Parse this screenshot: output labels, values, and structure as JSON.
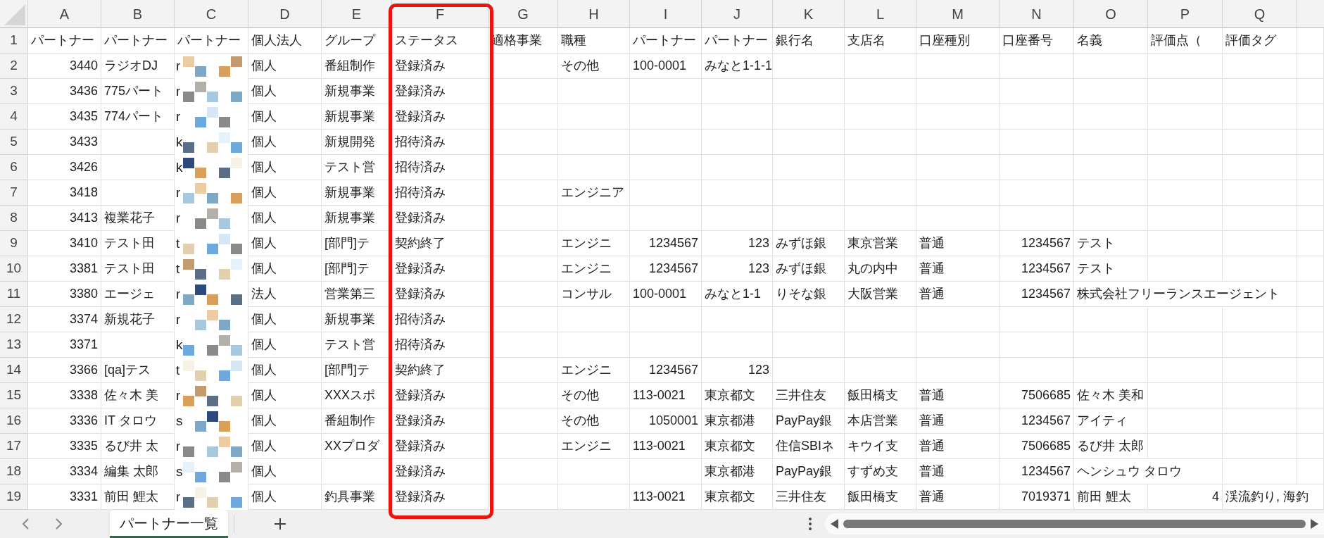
{
  "sheet": {
    "columns": [
      {
        "letter": "A",
        "highlighted": false
      },
      {
        "letter": "B",
        "highlighted": false
      },
      {
        "letter": "C",
        "highlighted": false
      },
      {
        "letter": "D",
        "highlighted": false
      },
      {
        "letter": "E",
        "highlighted": false
      },
      {
        "letter": "F",
        "highlighted": true
      },
      {
        "letter": "G",
        "highlighted": false
      },
      {
        "letter": "H",
        "highlighted": false
      },
      {
        "letter": "I",
        "highlighted": false
      },
      {
        "letter": "J",
        "highlighted": false
      },
      {
        "letter": "K",
        "highlighted": false
      },
      {
        "letter": "L",
        "highlighted": false
      },
      {
        "letter": "M",
        "highlighted": false
      },
      {
        "letter": "N",
        "highlighted": false
      },
      {
        "letter": "O",
        "highlighted": false
      },
      {
        "letter": "P",
        "highlighted": false
      },
      {
        "letter": "Q",
        "highlighted": false
      }
    ],
    "rows": [
      {
        "number": "1",
        "redacted": false,
        "cells": [
          "パートナー",
          "パートナー",
          "パートナー",
          "個人法人",
          "グループ",
          "ステータス",
          "適格事業",
          "職種",
          "パートナー",
          "パートナー",
          "銀行名",
          "支店名",
          "口座種別",
          "口座番号",
          "名義",
          "評価点（",
          "評価タグ"
        ],
        "numeric": [
          false,
          false,
          false,
          false,
          false,
          false,
          false,
          false,
          false,
          false,
          false,
          false,
          false,
          false,
          false,
          false,
          false
        ]
      },
      {
        "number": "2",
        "redacted": true,
        "redacted_head": "r",
        "cells": [
          "3440",
          "ラジオDJ",
          "",
          "個人",
          "番組制作",
          "登録済み",
          "",
          "その他",
          "100-0001",
          "みなと1-1-1",
          "",
          "",
          "",
          "",
          "",
          "",
          ""
        ],
        "numeric": [
          true,
          false,
          false,
          false,
          false,
          false,
          false,
          false,
          false,
          false,
          false,
          false,
          false,
          false,
          false,
          false,
          false
        ]
      },
      {
        "number": "3",
        "redacted": true,
        "redacted_head": "r",
        "cells": [
          "3436",
          "775パート",
          "",
          "個人",
          "新規事業",
          "登録済み",
          "",
          "",
          "",
          "",
          "",
          "",
          "",
          "",
          "",
          "",
          ""
        ],
        "numeric": [
          true,
          false,
          false,
          false,
          false,
          false,
          false,
          false,
          false,
          false,
          false,
          false,
          false,
          false,
          false,
          false,
          false
        ]
      },
      {
        "number": "4",
        "redacted": true,
        "redacted_head": "r",
        "cells": [
          "3435",
          "774パート",
          "",
          "個人",
          "新規事業",
          "登録済み",
          "",
          "",
          "",
          "",
          "",
          "",
          "",
          "",
          "",
          "",
          ""
        ],
        "numeric": [
          true,
          false,
          false,
          false,
          false,
          false,
          false,
          false,
          false,
          false,
          false,
          false,
          false,
          false,
          false,
          false,
          false
        ]
      },
      {
        "number": "5",
        "redacted": true,
        "redacted_head": "k",
        "cells": [
          "3433",
          "",
          "",
          "個人",
          "新規開発",
          "招待済み",
          "",
          "",
          "",
          "",
          "",
          "",
          "",
          "",
          "",
          "",
          ""
        ],
        "numeric": [
          true,
          false,
          false,
          false,
          false,
          false,
          false,
          false,
          false,
          false,
          false,
          false,
          false,
          false,
          false,
          false,
          false
        ]
      },
      {
        "number": "6",
        "redacted": true,
        "redacted_head": "k",
        "cells": [
          "3426",
          "",
          "",
          "個人",
          "テスト営",
          "招待済み",
          "",
          "",
          "",
          "",
          "",
          "",
          "",
          "",
          "",
          "",
          ""
        ],
        "numeric": [
          true,
          false,
          false,
          false,
          false,
          false,
          false,
          false,
          false,
          false,
          false,
          false,
          false,
          false,
          false,
          false,
          false
        ]
      },
      {
        "number": "7",
        "redacted": true,
        "redacted_head": "r",
        "cells": [
          "3418",
          "",
          "",
          "個人",
          "新規事業",
          "招待済み",
          "",
          "エンジニア",
          "",
          "",
          "",
          "",
          "",
          "",
          "",
          "",
          ""
        ],
        "numeric": [
          true,
          false,
          false,
          false,
          false,
          false,
          false,
          false,
          false,
          false,
          false,
          false,
          false,
          false,
          false,
          false,
          false
        ]
      },
      {
        "number": "8",
        "redacted": true,
        "redacted_head": "r",
        "cells": [
          "3413",
          "複業花子",
          "",
          "個人",
          "新規事業",
          "登録済み",
          "",
          "",
          "",
          "",
          "",
          "",
          "",
          "",
          "",
          "",
          ""
        ],
        "numeric": [
          true,
          false,
          false,
          false,
          false,
          false,
          false,
          false,
          false,
          false,
          false,
          false,
          false,
          false,
          false,
          false,
          false
        ]
      },
      {
        "number": "9",
        "redacted": true,
        "redacted_head": "t",
        "cells": [
          "3410",
          "テスト田",
          "",
          "個人",
          "[部門]テ",
          "契約終了",
          "",
          "エンジニ",
          "1234567",
          "123",
          "みずほ銀",
          "東京営業",
          "普通",
          "1234567",
          "テスト",
          "",
          ""
        ],
        "numeric": [
          true,
          false,
          false,
          false,
          false,
          false,
          false,
          false,
          true,
          true,
          false,
          false,
          false,
          true,
          false,
          false,
          false
        ]
      },
      {
        "number": "10",
        "redacted": true,
        "redacted_head": "t",
        "cells": [
          "3381",
          "テスト田",
          "",
          "個人",
          "[部門]テ",
          "登録済み",
          "",
          "エンジニ",
          "1234567",
          "123",
          "みずほ銀",
          "丸の内中",
          "普通",
          "1234567",
          "テスト",
          "",
          ""
        ],
        "numeric": [
          true,
          false,
          false,
          false,
          false,
          false,
          false,
          false,
          true,
          true,
          false,
          false,
          false,
          true,
          false,
          false,
          false
        ]
      },
      {
        "number": "11",
        "redacted": true,
        "redacted_head": "r",
        "cells": [
          "3380",
          "エージェ",
          "",
          "法人",
          "営業第三",
          "登録済み",
          "",
          "コンサル",
          "100-0001",
          "みなと1-1",
          "りそな銀",
          "大阪営業",
          "普通",
          "1234567",
          "株式会社フリーランスエージェント",
          "",
          ""
        ],
        "numeric": [
          true,
          false,
          false,
          false,
          false,
          false,
          false,
          false,
          false,
          false,
          false,
          false,
          false,
          true,
          false,
          false,
          false
        ]
      },
      {
        "number": "12",
        "redacted": true,
        "redacted_head": "r",
        "cells": [
          "3374",
          "新規花子",
          "",
          "個人",
          "新規事業",
          "招待済み",
          "",
          "",
          "",
          "",
          "",
          "",
          "",
          "",
          "",
          "",
          ""
        ],
        "numeric": [
          true,
          false,
          false,
          false,
          false,
          false,
          false,
          false,
          false,
          false,
          false,
          false,
          false,
          false,
          false,
          false,
          false
        ]
      },
      {
        "number": "13",
        "redacted": true,
        "redacted_head": "k",
        "cells": [
          "3371",
          "",
          "",
          "個人",
          "テスト営",
          "招待済み",
          "",
          "",
          "",
          "",
          "",
          "",
          "",
          "",
          "",
          "",
          ""
        ],
        "numeric": [
          true,
          false,
          false,
          false,
          false,
          false,
          false,
          false,
          false,
          false,
          false,
          false,
          false,
          false,
          false,
          false,
          false
        ]
      },
      {
        "number": "14",
        "redacted": true,
        "redacted_head": "t",
        "cells": [
          "3366",
          "[qa]テス",
          "",
          "個人",
          "[部門]テ",
          "契約終了",
          "",
          "エンジニ",
          "1234567",
          "123",
          "",
          "",
          "",
          "",
          "",
          "",
          ""
        ],
        "numeric": [
          true,
          false,
          false,
          false,
          false,
          false,
          false,
          false,
          true,
          true,
          false,
          false,
          false,
          false,
          false,
          false,
          false
        ]
      },
      {
        "number": "15",
        "redacted": true,
        "redacted_head": "r",
        "cells": [
          "3338",
          "佐々木 美",
          "",
          "個人",
          "XXXスポ",
          "登録済み",
          "",
          "その他",
          "113-0021",
          "東京都文",
          "三井住友",
          "飯田橋支",
          "普通",
          "7506685",
          "佐々木 美和",
          "",
          ""
        ],
        "numeric": [
          true,
          false,
          false,
          false,
          false,
          false,
          false,
          false,
          false,
          false,
          false,
          false,
          false,
          true,
          false,
          false,
          false
        ]
      },
      {
        "number": "16",
        "redacted": true,
        "redacted_head": "s",
        "cells": [
          "3336",
          "IT タロウ",
          "",
          "個人",
          "番組制作",
          "登録済み",
          "",
          "その他",
          "1050001",
          "東京都港",
          "PayPay銀",
          "本店営業",
          "普通",
          "1234567",
          "アイティ",
          "",
          ""
        ],
        "numeric": [
          true,
          false,
          false,
          false,
          false,
          false,
          false,
          false,
          true,
          false,
          false,
          false,
          false,
          true,
          false,
          false,
          false
        ]
      },
      {
        "number": "17",
        "redacted": true,
        "redacted_head": "r",
        "cells": [
          "3335",
          "るび井 太",
          "",
          "個人",
          "XXプロダ",
          "登録済み",
          "",
          "エンジニ",
          "113-0021",
          "東京都文",
          "住信SBIネ",
          "キウイ支",
          "普通",
          "7506685",
          "るび井 太郎",
          "",
          ""
        ],
        "numeric": [
          true,
          false,
          false,
          false,
          false,
          false,
          false,
          false,
          false,
          false,
          false,
          false,
          false,
          true,
          false,
          false,
          false
        ]
      },
      {
        "number": "18",
        "redacted": true,
        "redacted_head": "s",
        "cells": [
          "3334",
          "編集 太郎",
          "",
          "個人",
          "",
          "登録済み",
          "",
          "",
          "",
          "東京都港",
          "PayPay銀",
          "すずめ支",
          "普通",
          "1234567",
          "ヘンシュウ タロウ",
          "",
          ""
        ],
        "numeric": [
          true,
          false,
          false,
          false,
          false,
          false,
          false,
          false,
          false,
          false,
          false,
          false,
          false,
          true,
          false,
          false,
          false
        ]
      },
      {
        "number": "19",
        "redacted": true,
        "redacted_head": "r",
        "cells": [
          "3331",
          "前田 鯉太",
          "",
          "個人",
          "釣具事業",
          "登録済み",
          "",
          "",
          "113-0021",
          "東京都文",
          "三井住友",
          "飯田橋支",
          "普通",
          "7019371",
          "前田 鯉太",
          "4",
          "渓流釣り, 海釣"
        ],
        "numeric": [
          true,
          false,
          false,
          false,
          false,
          false,
          false,
          false,
          false,
          false,
          false,
          false,
          false,
          true,
          false,
          true,
          false
        ]
      }
    ]
  },
  "sheet_tabs": [
    {
      "label": "パートナー一覧",
      "selected": true
    }
  ]
}
